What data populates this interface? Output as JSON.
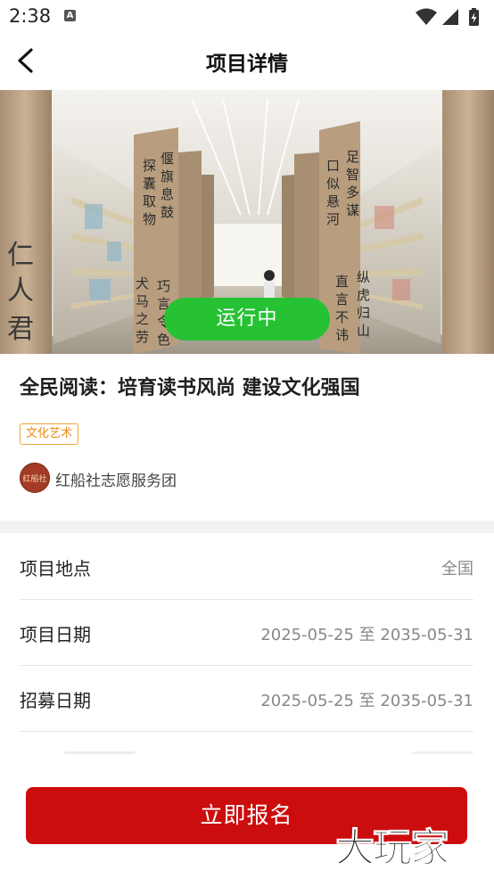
{
  "status_bar": {
    "time": "2:38",
    "notification_icon": "a-icon",
    "icons": [
      "wifi-icon",
      "signal-icon",
      "battery-charging-icon"
    ]
  },
  "nav": {
    "back_icon": "chevron-left-icon",
    "title": "项目详情"
  },
  "hero": {
    "status": "运行中",
    "status_color": "#26c234",
    "pillar_text": [
      "仁人君",
      "探囊取物",
      "偃旗息鼓",
      "犬马之劳",
      "巧言令色",
      "口似悬河",
      "足智多谋",
      "直言不讳",
      "纵虎归山"
    ]
  },
  "project": {
    "title": "全民阅读：培育读书风尚 建设文化强国",
    "category": "文化艺术",
    "category_color": "#ec8c12",
    "organization": "红船社志愿服务团",
    "org_avatar_text": "红船社"
  },
  "details": [
    {
      "label": "项目地点",
      "value": "全国"
    },
    {
      "label": "项目日期",
      "value": "2025-05-25 至 2035-05-31"
    },
    {
      "label": "招募日期",
      "value": "2025-05-25 至 2035-05-31"
    }
  ],
  "action": {
    "signup_label": "立即报名",
    "signup_color": "#cc0d0d"
  },
  "watermark": {
    "text": "大玩家"
  }
}
